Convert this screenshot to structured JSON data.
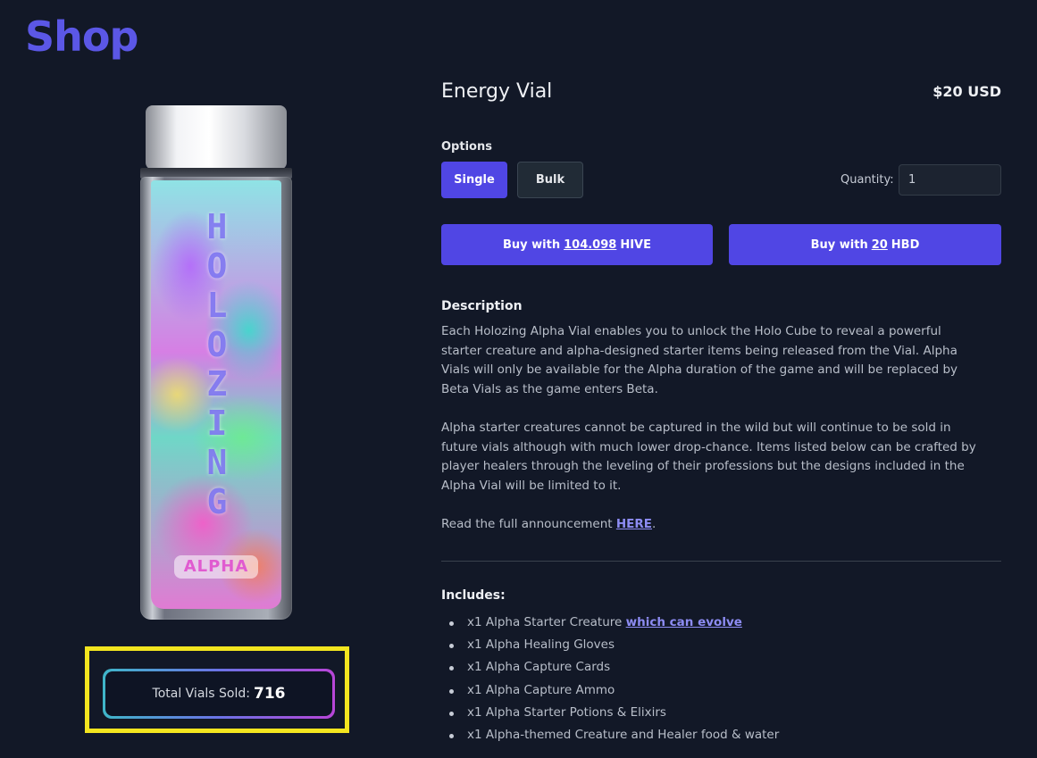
{
  "page": {
    "title": "Shop"
  },
  "product": {
    "image": {
      "brand_text": "HOLOZING",
      "tag_text": "ALPHA"
    },
    "total_sold_label": "Total Vials Sold:",
    "total_sold_value": "716",
    "name": "Energy Vial",
    "price": "$20 USD",
    "options_label": "Options",
    "options": [
      {
        "label": "Single",
        "selected": true
      },
      {
        "label": "Bulk",
        "selected": false
      }
    ],
    "quantity_label": "Quantity:",
    "quantity_value": "1",
    "buy_hive": {
      "prefix": "Buy with",
      "amount": "104.098",
      "currency": "HIVE"
    },
    "buy_hbd": {
      "prefix": "Buy with",
      "amount": "20",
      "currency": "HBD"
    }
  },
  "description": {
    "title": "Description",
    "paragraph1": "Each Holozing Alpha Vial enables you to unlock the Holo Cube to reveal a powerful starter creature and alpha-designed starter items being released from the Vial. Alpha Vials will only be available for the Alpha duration of the game and will be replaced by Beta Vials as the game enters Beta.",
    "paragraph2": "Alpha starter creatures cannot be captured in the wild but will continue to be sold in future vials although with much lower drop-chance. Items listed below can be crafted by player healers through the leveling of their professions but the designs included in the Alpha Vial will be limited to it.",
    "announcement_prefix": "Read the full announcement",
    "announcement_link": "HERE",
    "announcement_suffix": "."
  },
  "includes": {
    "title": "Includes:",
    "items": [
      {
        "text": "x1 Alpha Starter Creature",
        "link": "which can evolve"
      },
      {
        "text": "x1 Alpha Healing Gloves"
      },
      {
        "text": "x1 Alpha Capture Cards"
      },
      {
        "text": "x1 Alpha Capture Ammo"
      },
      {
        "text": "x1 Alpha Starter Potions & Elixirs"
      },
      {
        "text": "x1 Alpha-themed Creature and Healer food & water"
      }
    ]
  },
  "colors": {
    "background": "#121827",
    "accent": "#5046e4",
    "title": "#5b57e6",
    "highlight": "#f3e51f"
  }
}
